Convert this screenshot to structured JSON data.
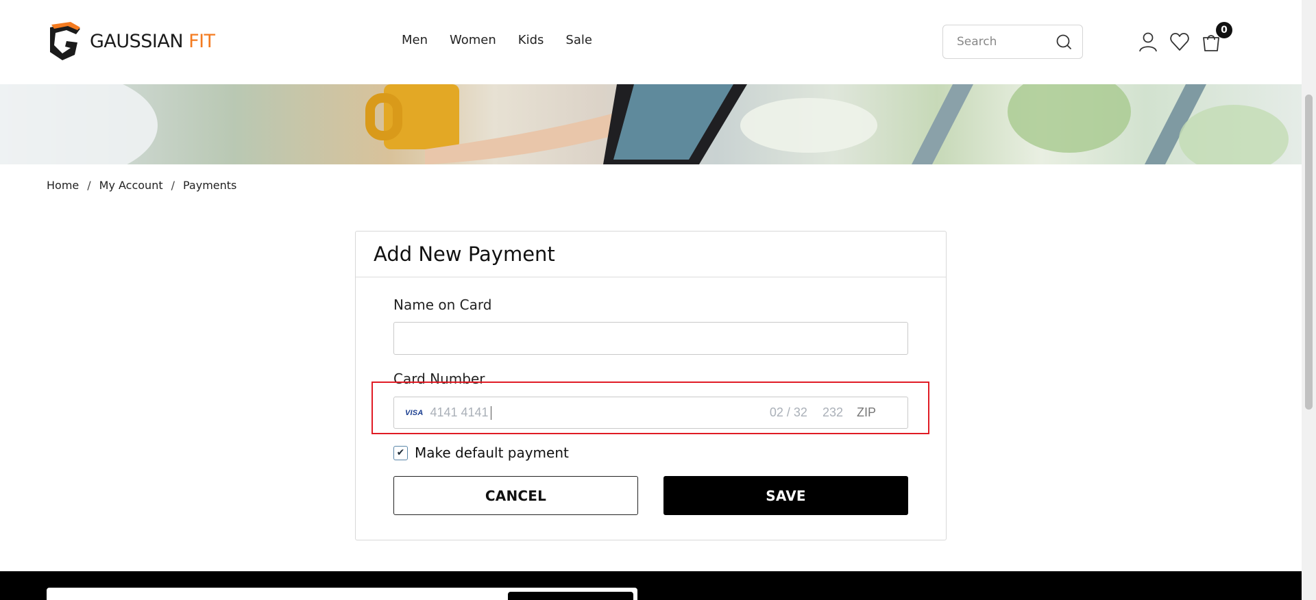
{
  "brand": {
    "name_part1": "GAUSSIAN",
    "name_part2": "FIT",
    "accent_color": "#f47b20"
  },
  "nav": [
    "Men",
    "Women",
    "Kids",
    "Sale"
  ],
  "search": {
    "placeholder": "Search",
    "icon": "search-icon"
  },
  "header_icons": [
    "user-icon",
    "heart-icon",
    "cart-icon"
  ],
  "cart": {
    "count": "0"
  },
  "breadcrumb": {
    "home": "Home",
    "account": "My Account",
    "current": "Payments",
    "separator": "/"
  },
  "form": {
    "title": "Add New Payment",
    "name_label": "Name on Card",
    "name_value": "",
    "card_label": "Card Number",
    "card_brand": "VISA",
    "card_number": "4141 4141",
    "expiry_placeholder": "02 / 32",
    "cvc_placeholder": "232",
    "zip_placeholder": "ZIP",
    "default_label": "Make default payment",
    "default_checked": true,
    "cancel_label": "CANCEL",
    "save_label": "SAVE"
  },
  "highlight_color": "#e01b24"
}
